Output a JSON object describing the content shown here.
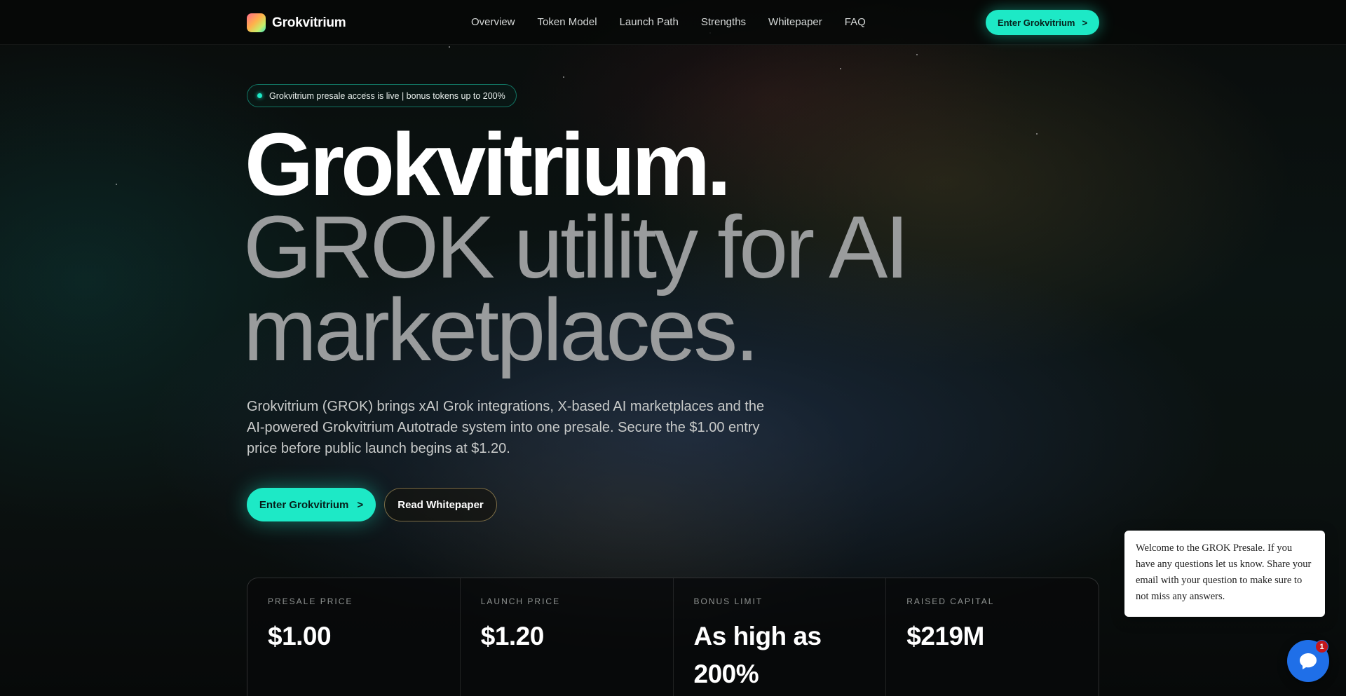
{
  "nav": {
    "brand": "Grokvitrium",
    "links": [
      "Overview",
      "Token Model",
      "Launch Path",
      "Strengths",
      "Whitepaper",
      "FAQ"
    ],
    "cta_label": "Enter Grokvitrium",
    "cta_arrow": ">"
  },
  "hero": {
    "announcement": "Grokvitrium presale access is live | bonus tokens up to 200%",
    "title": "Grokvitrium.",
    "subtitle_line1": "GROK utility for AI",
    "subtitle_line2": "marketplaces.",
    "lede": "Grokvitrium (GROK) brings xAI Grok integrations, X-based AI marketplaces and the AI-powered Grokvitrium Autotrade system into one presale. Secure the $1.00 entry price before public launch begins at $1.20.",
    "primary_label": "Enter Grokvitrium",
    "primary_arrow": ">",
    "secondary_label": "Read Whitepaper"
  },
  "stats": [
    {
      "label": "PRESALE PRICE",
      "value": "$1.00"
    },
    {
      "label": "LAUNCH PRICE",
      "value": "$1.20"
    },
    {
      "label": "BONUS LIMIT",
      "value": "As high as 200%"
    },
    {
      "label": "RAISED CAPITAL",
      "value": "$219M"
    }
  ],
  "chat": {
    "message": "Welcome to the GROK Presale. If you have any questions let us know. Share your email with your question to make sure to not miss any answers.",
    "badge_count": "1"
  },
  "colors": {
    "accent": "#1de9c6",
    "chat_blue": "#1f6fe8",
    "badge_red": "#c4161c"
  }
}
